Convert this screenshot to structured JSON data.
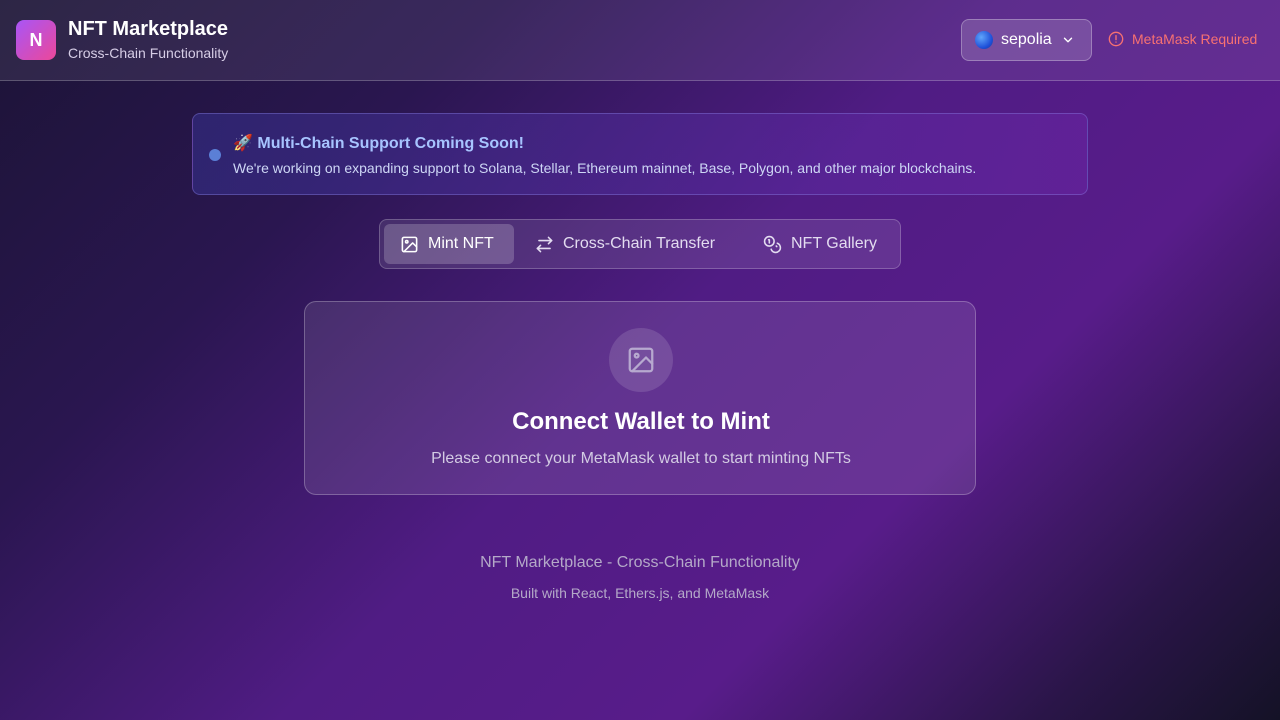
{
  "header": {
    "logo_letter": "N",
    "title": "NFT Marketplace",
    "subtitle": "Cross-Chain Functionality",
    "network": {
      "selected": "sepolia",
      "icon": "network-globe-icon"
    },
    "warning": {
      "text": "MetaMask Required",
      "icon": "alert-circle-icon",
      "color": "#f87171"
    }
  },
  "banner": {
    "emoji": "🚀",
    "title": "Multi-Chain Support Coming Soon!",
    "text": "We're working on expanding support to Solana, Stellar, Ethereum mainnet, Base, Polygon, and other major blockchains."
  },
  "tabs": [
    {
      "label": "Mint NFT",
      "icon": "image-icon",
      "active": true
    },
    {
      "label": "Cross-Chain Transfer",
      "icon": "arrows-swap-icon",
      "active": false
    },
    {
      "label": "NFT Gallery",
      "icon": "coins-icon",
      "active": false
    }
  ],
  "card": {
    "icon": "image-icon",
    "title": "Connect Wallet to Mint",
    "description": "Please connect your MetaMask wallet to start minting NFTs"
  },
  "footer": {
    "line1": "NFT Marketplace - Cross-Chain Functionality",
    "line2": "Built with React, Ethers.js, and MetaMask"
  },
  "colors": {
    "accent_gradient_start": "#a855f7",
    "accent_gradient_end": "#ec4899",
    "banner_title": "#a7c4ff"
  }
}
